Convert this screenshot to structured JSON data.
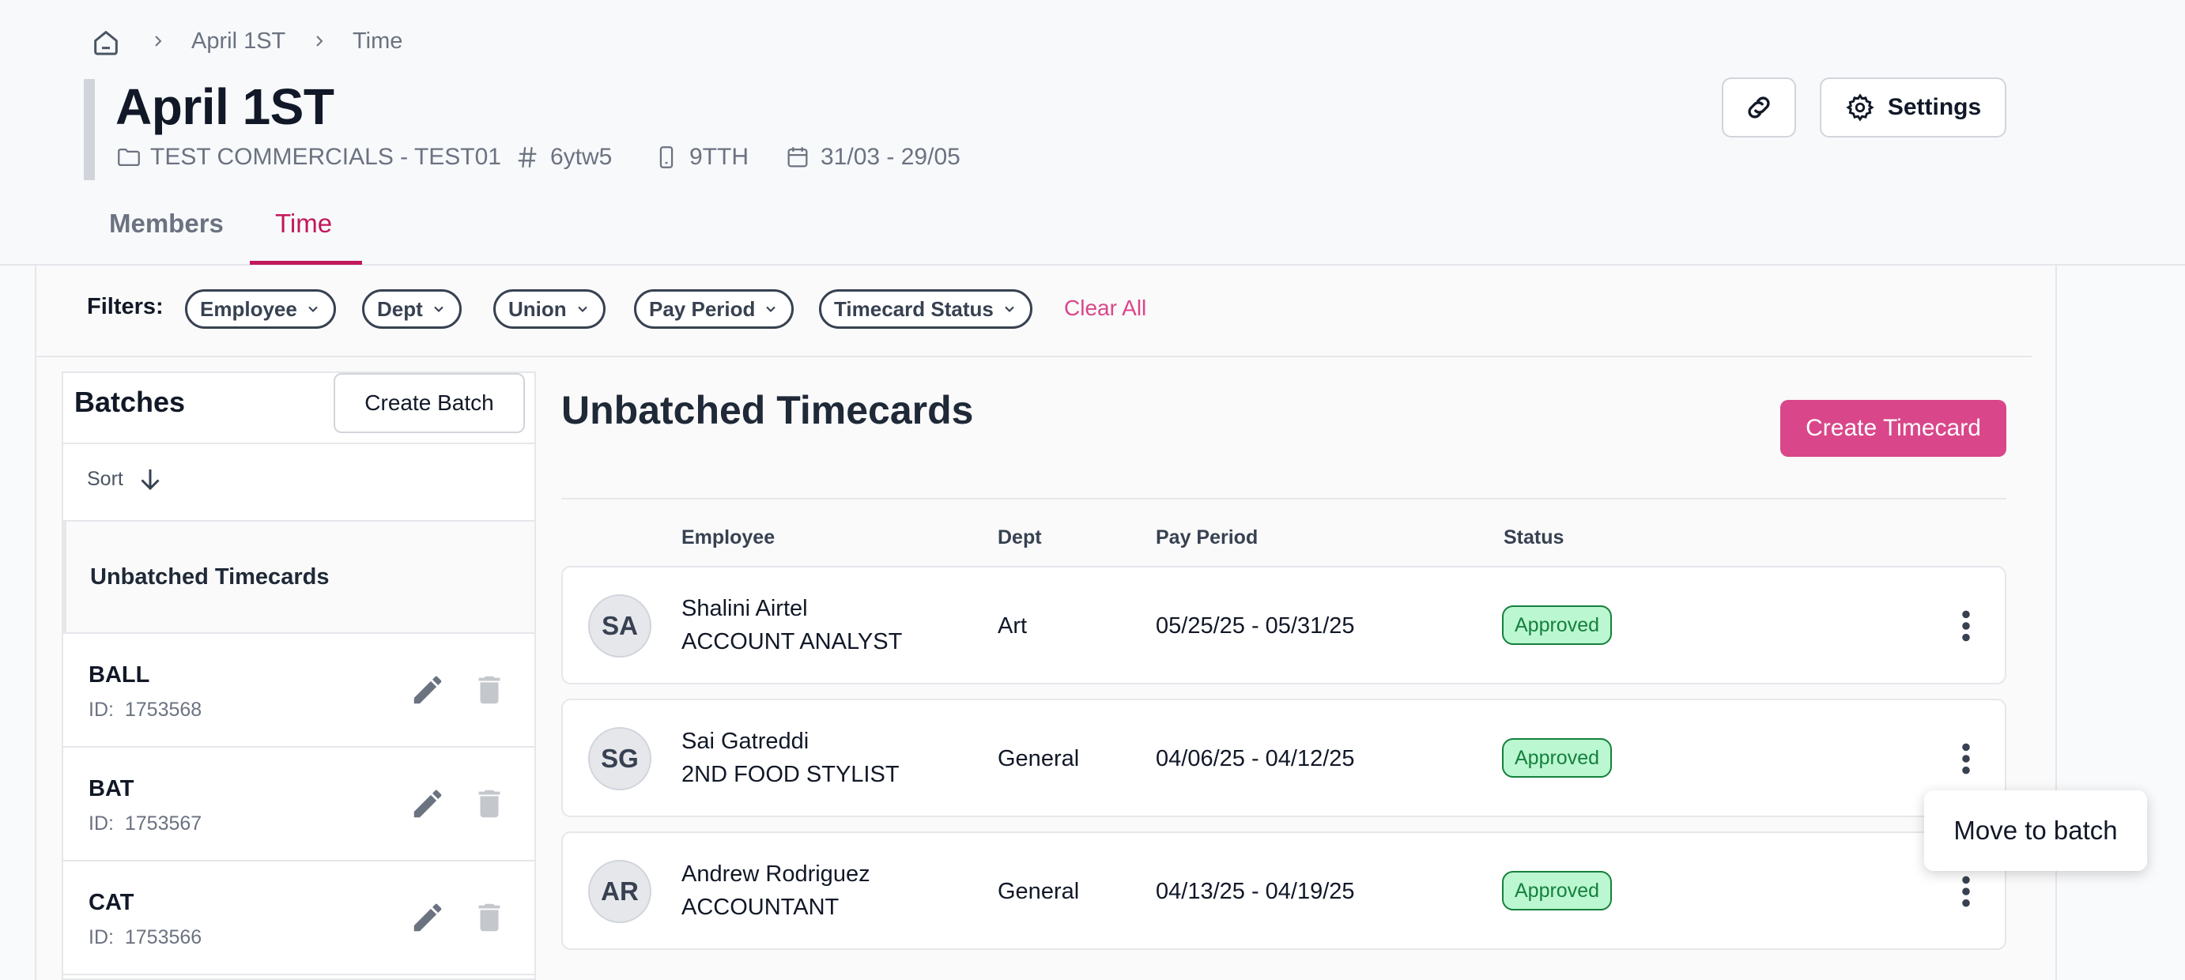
{
  "breadcrumb": {
    "items": [
      "April 1ST",
      "Time"
    ]
  },
  "header": {
    "title": "April 1ST",
    "meta": {
      "project": "TEST COMMERCIALS - TEST01",
      "code": "6ytw5",
      "device": "9TTH",
      "dates": "31/03 - 29/05"
    },
    "settings_label": "Settings"
  },
  "tabs": [
    {
      "label": "Members"
    },
    {
      "label": "Time",
      "active": true
    }
  ],
  "filters": {
    "label": "Filters:",
    "pills": [
      "Employee",
      "Dept",
      "Union",
      "Pay Period",
      "Timecard Status"
    ],
    "clear_all": "Clear All"
  },
  "batches": {
    "title": "Batches",
    "create_label": "Create Batch",
    "sort_label": "Sort",
    "unbatched_label": "Unbatched Timecards",
    "items": [
      {
        "name": "BALL",
        "id_label": "ID:",
        "id": "1753568"
      },
      {
        "name": "BAT",
        "id_label": "ID:",
        "id": "1753567"
      },
      {
        "name": "CAT",
        "id_label": "ID:",
        "id": "1753566"
      }
    ]
  },
  "timecards": {
    "title": "Unbatched Timecards",
    "create_label": "Create Timecard",
    "columns": [
      "Employee",
      "Dept",
      "Pay Period",
      "Status"
    ],
    "rows": [
      {
        "initials": "SA",
        "name": "Shalini Airtel",
        "role": "ACCOUNT ANALYST",
        "dept": "Art",
        "period": "05/25/25 - 05/31/25",
        "status": "Approved"
      },
      {
        "initials": "SG",
        "name": "Sai Gatreddi",
        "role": "2ND FOOD STYLIST",
        "dept": "General",
        "period": "04/06/25 - 04/12/25",
        "status": "Approved"
      },
      {
        "initials": "AR",
        "name": "Andrew Rodriguez",
        "role": "ACCOUNTANT",
        "dept": "General",
        "period": "04/13/25 - 04/19/25",
        "status": "Approved"
      }
    ]
  },
  "context_menu": {
    "item": "Move to batch"
  },
  "colors": {
    "accent": "#d9478a",
    "status_bg": "#bbf7d0",
    "status_fg": "#15803d"
  }
}
